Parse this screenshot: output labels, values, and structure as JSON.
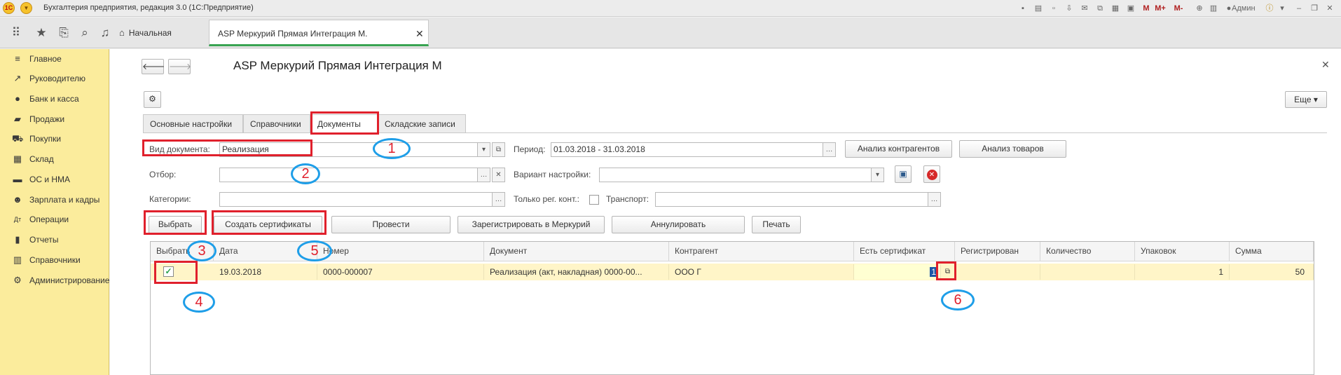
{
  "window": {
    "title": "Бухгалтерия предприятия, редакция 3.0  (1С:Предприятие)",
    "user": "Админ",
    "m_labels": [
      "M",
      "M+",
      "M-"
    ]
  },
  "tabs": [
    {
      "label": "Начальная страница"
    },
    {
      "label": "ASP Меркурий Прямая Интеграция М."
    }
  ],
  "sidebar": {
    "items": [
      {
        "icon": "menu-lines-icon",
        "label": "Главное"
      },
      {
        "icon": "chart-line-icon",
        "label": "Руководителю"
      },
      {
        "icon": "coin-icon",
        "label": "Банк и касса"
      },
      {
        "icon": "shopping-bag-icon",
        "label": "Продажи"
      },
      {
        "icon": "cart-icon",
        "label": "Покупки"
      },
      {
        "icon": "warehouse-grid-icon",
        "label": "Склад"
      },
      {
        "icon": "truck-icon",
        "label": "ОС и НМА"
      },
      {
        "icon": "people-icon",
        "label": "Зарплата и кадры"
      },
      {
        "icon": "dt-kt-icon",
        "label": "Операции"
      },
      {
        "icon": "bar-chart-icon",
        "label": "Отчеты"
      },
      {
        "icon": "book-icon",
        "label": "Справочники"
      },
      {
        "icon": "gear-icon",
        "label": "Администрирование"
      }
    ]
  },
  "form": {
    "title": "ASP Меркурий Прямая Интеграция М",
    "more_label": "Еще",
    "inner_tabs": [
      "Основные настройки",
      "Справочники",
      "Документы",
      "Складские записи"
    ],
    "fields": {
      "doc_type_label": "Вид документа:",
      "doc_type_value": "Реализация",
      "period_label": "Период:",
      "period_value": "01.03.2018 - 31.03.2018",
      "filter_label": "Отбор:",
      "filter_value": "",
      "variant_label": "Вариант настройки:",
      "variant_value": "",
      "categories_label": "Категории:",
      "categories_value": "",
      "only_reg_label": "Только рег. конт.:",
      "only_reg_checked": false,
      "transport_label": "Транспорт:",
      "transport_value": ""
    },
    "buttons": {
      "analyze_contractors": "Анализ контрагентов",
      "analyze_goods": "Анализ товаров",
      "select": "Выбрать",
      "create_certs": "Создать сертификаты",
      "post": "Провести",
      "register_mercury": "Зарегистрировать в Меркурий",
      "cancel": "Аннулировать",
      "print": "Печать"
    },
    "table": {
      "columns": [
        "Выбрать",
        "Дата",
        "Номер",
        "Документ",
        "Контрагент",
        "Есть сертификат",
        "Регистрирован",
        "Количество",
        "Упаковок",
        "Сумма"
      ],
      "rows": [
        {
          "selected": true,
          "date": "19.03.2018",
          "number": "0000-000007",
          "document": "Реализация (акт, накладная) 0000-00...",
          "contractor": "ООО  Г",
          "has_cert": "1",
          "registered": "",
          "quantity": "",
          "packages": "1",
          "sum": "50"
        }
      ]
    }
  },
  "callouts": [
    "1",
    "2",
    "3",
    "4",
    "5",
    "6"
  ],
  "colors": {
    "sidebar_bg": "#fbec9c",
    "row_highlight": "#fff5c8",
    "accent_green": "#38a351",
    "annotation_red": "#e0202c",
    "annotation_blue": "#1e9ee8"
  }
}
